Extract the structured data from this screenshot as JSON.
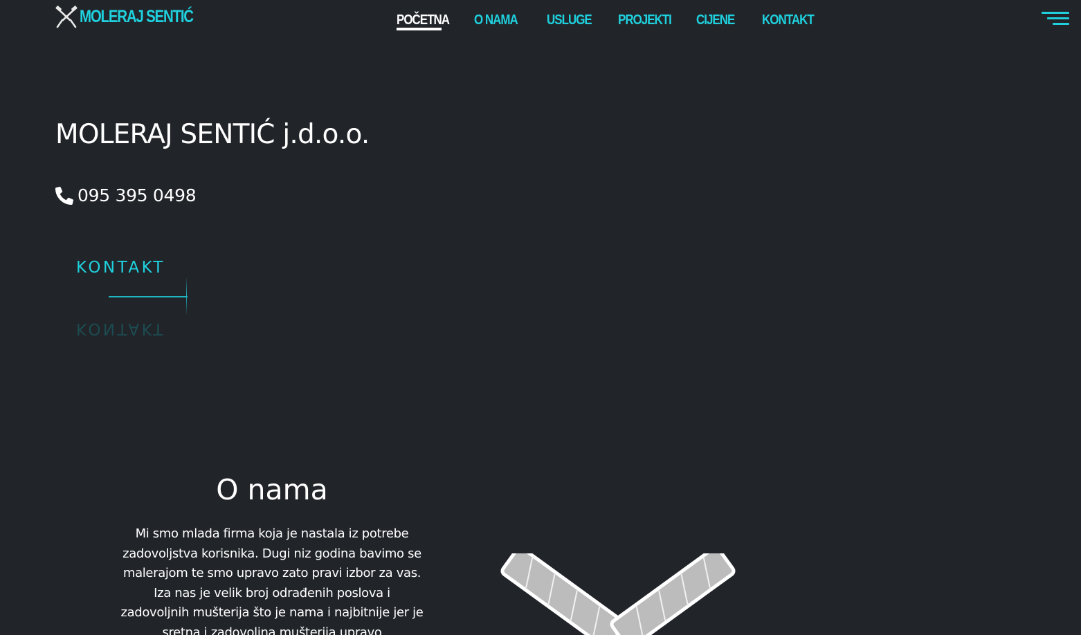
{
  "header": {
    "logo_text": "MOLERAJ SENTIĆ",
    "nav": [
      {
        "label": "POČETNA",
        "active": true
      },
      {
        "label": "O NAMA",
        "active": false
      },
      {
        "label": "USLUGE",
        "active": false
      },
      {
        "label": "PROJEKTI",
        "active": false
      },
      {
        "label": "CIJENE",
        "active": false
      },
      {
        "label": "KONTAKT",
        "active": false
      }
    ],
    "menu_icon": "hamburger-menu-icon"
  },
  "hero": {
    "title": "MOLERAJ SENTIĆ j.d.o.o.",
    "phone_icon": "phone-icon",
    "phone": "095 395 0498",
    "cta_label": "KONTAKT"
  },
  "about": {
    "title": "O nama",
    "text": "Mi smo mlada firma koja je nastala iz potrebe zadovoljstva korisnika. Dugi niz godina bavimo se malerajom te smo upravo zato pravi izbor za vas. Iza nas je velik broj odrađenih poslova i zadovoljnih mušterija što je nama i najbitnije jer je sretna i zadovoljna mušterija upravo"
  },
  "colors": {
    "background": "#212429",
    "accent": "#1fd1de",
    "text": "#ffffff"
  }
}
